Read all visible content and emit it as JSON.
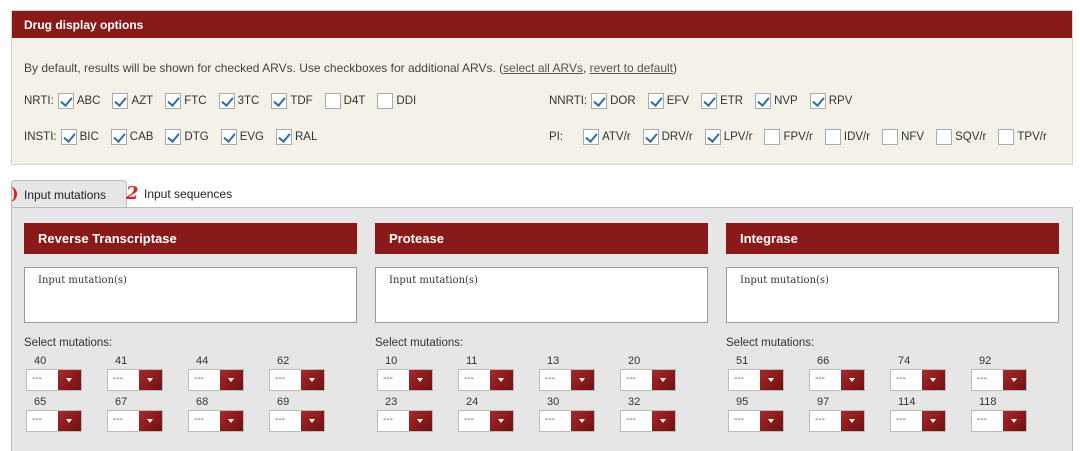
{
  "drug_options": {
    "title": "Drug display options",
    "description": "By default, results will be shown for checked ARVs. Use checkboxes for additional ARVs. (",
    "select_all": "select all ARVs",
    "separator": ", ",
    "revert": "revert to default",
    "close_paren": ")",
    "nrti": {
      "label": "NRTI:",
      "drugs": [
        {
          "name": "ABC",
          "checked": true
        },
        {
          "name": "AZT",
          "checked": true
        },
        {
          "name": "FTC",
          "checked": true
        },
        {
          "name": "3TC",
          "checked": true
        },
        {
          "name": "TDF",
          "checked": true
        },
        {
          "name": "D4T",
          "checked": false
        },
        {
          "name": "DDI",
          "checked": false
        }
      ]
    },
    "nnrti": {
      "label": "NNRTI:",
      "drugs": [
        {
          "name": "DOR",
          "checked": true
        },
        {
          "name": "EFV",
          "checked": true
        },
        {
          "name": "ETR",
          "checked": true
        },
        {
          "name": "NVP",
          "checked": true
        },
        {
          "name": "RPV",
          "checked": true
        }
      ]
    },
    "insti": {
      "label": "INSTI:",
      "drugs": [
        {
          "name": "BIC",
          "checked": true
        },
        {
          "name": "CAB",
          "checked": true
        },
        {
          "name": "DTG",
          "checked": true
        },
        {
          "name": "EVG",
          "checked": true
        },
        {
          "name": "RAL",
          "checked": true
        }
      ]
    },
    "pi": {
      "label": "PI:",
      "drugs": [
        {
          "name": "ATV/r",
          "checked": true
        },
        {
          "name": "DRV/r",
          "checked": true
        },
        {
          "name": "LPV/r",
          "checked": true
        },
        {
          "name": "FPV/r",
          "checked": false
        },
        {
          "name": "IDV/r",
          "checked": false
        },
        {
          "name": "NFV",
          "checked": false
        },
        {
          "name": "SQV/r",
          "checked": false
        },
        {
          "name": "TPV/r",
          "checked": false
        }
      ]
    }
  },
  "tabs": {
    "active": "Input mutations",
    "inactive": "Input sequences",
    "anno1": ")",
    "anno2": "2"
  },
  "columns": [
    {
      "header": "Reverse Transcriptase",
      "placeholder": "Input mutation(s)",
      "select_label": "Select mutations:",
      "positions": [
        "40",
        "41",
        "44",
        "62",
        "65",
        "67",
        "68",
        "69"
      ],
      "default_value": "---"
    },
    {
      "header": "Protease",
      "placeholder": "Input mutation(s)",
      "select_label": "Select mutations:",
      "positions": [
        "10",
        "11",
        "13",
        "20",
        "23",
        "24",
        "30",
        "32"
      ],
      "default_value": "---"
    },
    {
      "header": "Integrase",
      "placeholder": "Input mutation(s)",
      "select_label": "Select mutations:",
      "positions": [
        "51",
        "66",
        "74",
        "92",
        "95",
        "97",
        "114",
        "118"
      ],
      "default_value": "---"
    }
  ],
  "colors": {
    "accent": "#8a1a1a",
    "panel_bg": "#f4f2e8",
    "tab_bg": "#e6e6e6",
    "annotation": "#e02020"
  }
}
